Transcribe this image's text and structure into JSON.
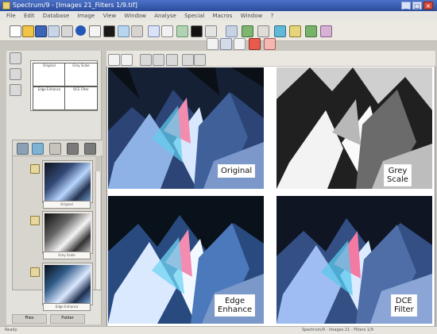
{
  "window": {
    "title": "Spectrum/9 - [Images 21_Filters 1/9.tif]",
    "controls": [
      "_",
      "□",
      "×"
    ]
  },
  "menu": [
    "File",
    "Edit",
    "Database",
    "Image",
    "View",
    "Window",
    "Analyse",
    "Special",
    "Macros",
    "Window",
    "?"
  ],
  "icons": [
    "new-icon",
    "open-icon",
    "save-icon",
    "acquire-icon",
    "print-icon",
    "info-icon",
    "arrow-icon",
    "calibrate-icon",
    "zoom-icon",
    "crop-icon",
    "measure-icon",
    "text-icon",
    "filter-icon",
    "histogram-icon",
    "chart-icon",
    "grid-icon",
    "export-icon"
  ],
  "map_cells": [
    "Original",
    "Grey Scale",
    "Edge Enhance",
    "DCE Filter"
  ],
  "thumbnails": [
    {
      "label": "Original"
    },
    {
      "label": "Grey Scale"
    },
    {
      "label": "Edge Enhance"
    }
  ],
  "bottom_tabs": [
    "Files",
    "Folder"
  ],
  "viewer": {
    "captions": {
      "original": "Original",
      "grey": "Grey\nScale",
      "edge": "Edge\nEnhance",
      "dce": "DCE\nFilter"
    }
  },
  "status": {
    "left": "Ready",
    "right": "Spectrum/9 - Images 21 - Filters 1/9"
  },
  "colors": {
    "title": "#3b62b9",
    "crystal_dark": "#10151f",
    "crystal_light": "#d9e9ff",
    "accent_pink": "#f27aa3",
    "accent_cyan": "#59c8ec"
  }
}
